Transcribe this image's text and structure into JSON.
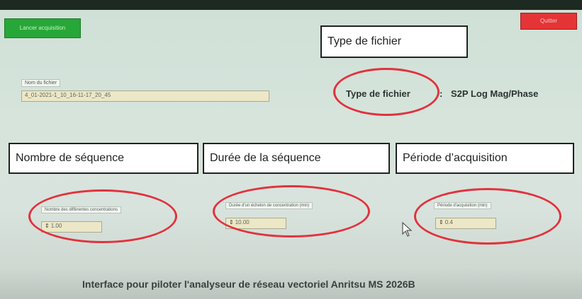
{
  "app": {
    "start_button": "Lancer acquisition",
    "quit_button": "Quitter"
  },
  "file": {
    "name_label": "Nom du fichier",
    "name_value": "4_01-2021-1_10_16-11-17_20_45"
  },
  "file_type": {
    "annotation": "Type de fichier",
    "label": "Type de fichier",
    "value": "S2P Log Mag/Phase"
  },
  "fields": [
    {
      "annotation": "Nombre  de séquence",
      "label": "Nombre des différentes concentrations",
      "value": "1.00"
    },
    {
      "annotation": "Durée de la séquence",
      "label": "Durée d'un échelon de concentration (min)",
      "value": "10.00"
    },
    {
      "annotation": "Période d’acquisition",
      "label": "Période d'acquisition (min)",
      "value": "0.4"
    }
  ],
  "footer": "Interface pour piloter l'analyseur de réseau vectoriel Anritsu MS 2026B",
  "colors": {
    "start_button": "#27a737",
    "quit_button": "#e43436",
    "annotation_circle": "#e2323d"
  },
  "icons": {
    "stepper": "up-down-arrows",
    "cursor": "mouse-pointer"
  }
}
